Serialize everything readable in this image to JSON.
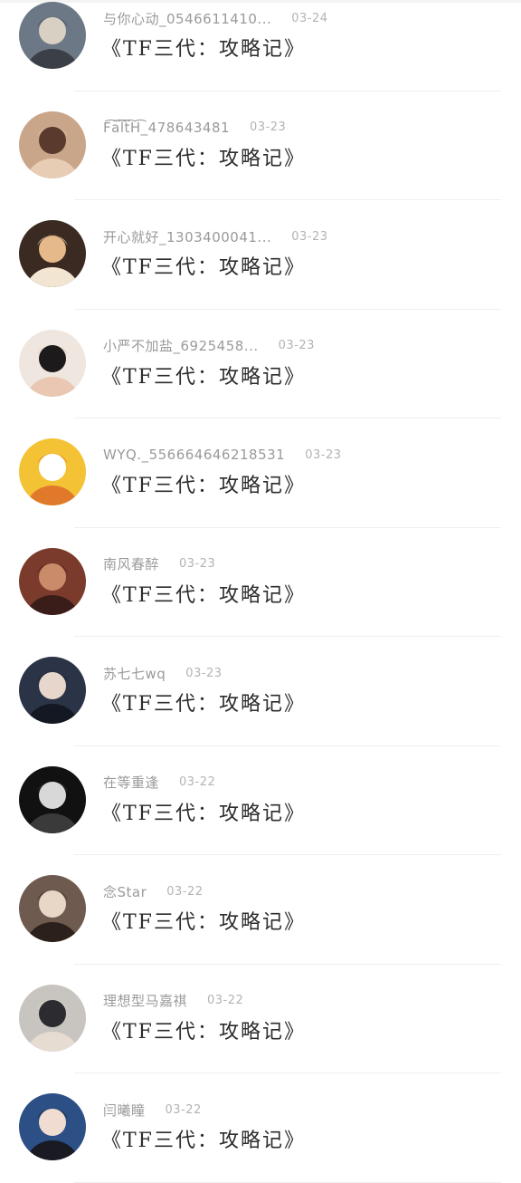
{
  "items": [
    {
      "username": "与你心动_0546611410...",
      "date": "03-24",
      "title": "《TF三代：攻略记》",
      "avatar_icon": "boy-portrait-avatar",
      "avatar_colors": [
        "#6d7886",
        "#d9d0c4",
        "#3b3f48"
      ]
    },
    {
      "username": "F͡a͡l͡t͡H͡_478643481",
      "date": "03-23",
      "title": "《TF三代：攻略记》",
      "avatar_icon": "girl-sunset-avatar",
      "avatar_colors": [
        "#c9a58a",
        "#5a3a2c",
        "#e8cdb5"
      ]
    },
    {
      "username": "开心就好_1303400041...",
      "date": "03-23",
      "title": "《TF三代：攻略记》",
      "avatar_icon": "cartoon-cat-avatar",
      "avatar_colors": [
        "#3a2a22",
        "#e6b98a",
        "#f2e5d2"
      ]
    },
    {
      "username": "小严不加盐_6925458...",
      "date": "03-23",
      "title": "《TF三代：攻略记》",
      "avatar_icon": "smiling-boy-avatar",
      "avatar_colors": [
        "#efe6df",
        "#1c1a1a",
        "#e9c7b2"
      ]
    },
    {
      "username": "WYQ._556664646218531",
      "date": "03-23",
      "title": "《TF三代：攻略记》",
      "avatar_icon": "cartoon-duck-avatar",
      "avatar_colors": [
        "#f4c235",
        "#ffffff",
        "#e07a2a"
      ]
    },
    {
      "username": "南风春醉",
      "date": "03-23",
      "title": "《TF三代：攻略记》",
      "avatar_icon": "street-shop-avatar",
      "avatar_colors": [
        "#7b3b2c",
        "#c98b6a",
        "#3a1d18"
      ]
    },
    {
      "username": "苏七七wq",
      "date": "03-23",
      "title": "《TF三代：攻略记》",
      "avatar_icon": "girl-dark-hair-avatar",
      "avatar_colors": [
        "#2b3446",
        "#e7d6cc",
        "#141822"
      ]
    },
    {
      "username": "在等重逢",
      "date": "03-22",
      "title": "《TF三代：攻略记》",
      "avatar_icon": "boy-black-white-avatar",
      "avatar_colors": [
        "#111111",
        "#d8d8d8",
        "#3a3a3a"
      ]
    },
    {
      "username": "念Star",
      "date": "03-22",
      "title": "《TF三代：攻略记》",
      "avatar_icon": "girl-room-avatar",
      "avatar_colors": [
        "#6e5a4e",
        "#e8d7c7",
        "#2b201b"
      ]
    },
    {
      "username": "理想型马嘉祺",
      "date": "03-22",
      "title": "《TF三代：攻略记》",
      "avatar_icon": "boy-group-avatar",
      "avatar_colors": [
        "#c8c4bf",
        "#2c2c30",
        "#e6dcd2"
      ]
    },
    {
      "username": "闫曦瞳",
      "date": "03-22",
      "title": "《TF三代：攻略记》",
      "avatar_icon": "girl-blue-top-avatar",
      "avatar_colors": [
        "#2c4f86",
        "#f0dcd0",
        "#1a1a22"
      ]
    }
  ]
}
